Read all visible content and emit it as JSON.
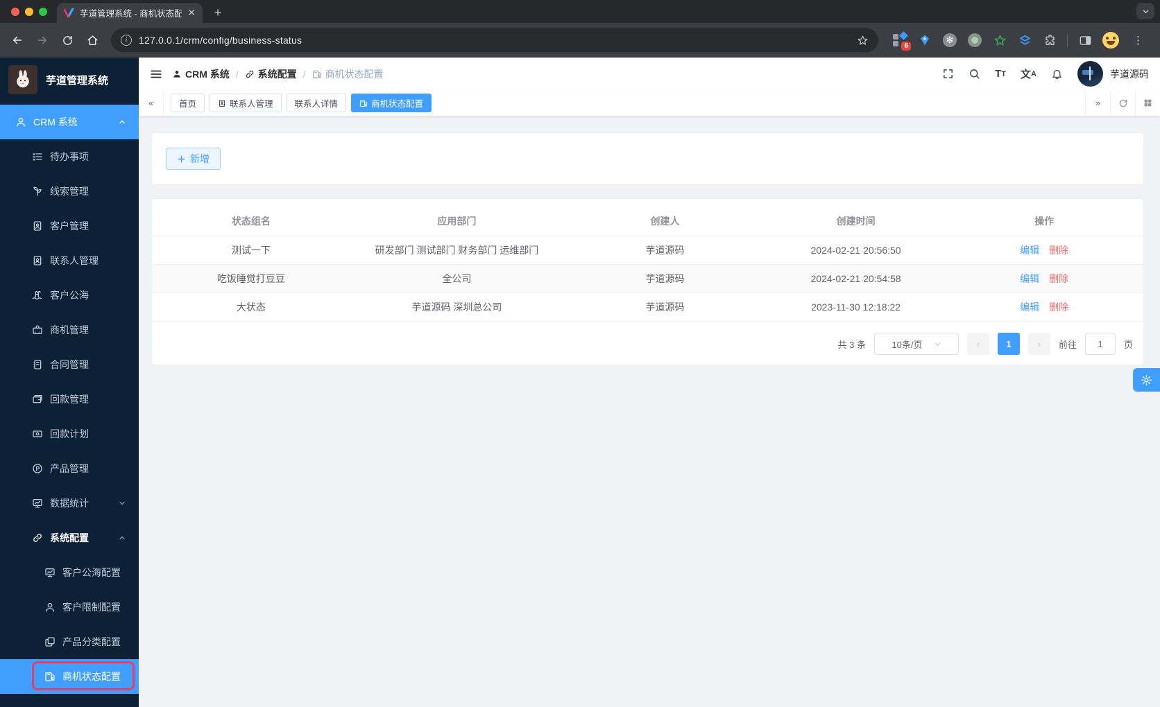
{
  "browser": {
    "tab_title": "芋道管理系统 - 商机状态配置",
    "url": "127.0.0.1/crm/config/business-status",
    "extension_badge": "6"
  },
  "sidebar": {
    "logo_title": "芋道管理系统",
    "menu": [
      {
        "label": "CRM 系统"
      },
      {
        "label": "待办事项"
      },
      {
        "label": "线索管理"
      },
      {
        "label": "客户管理"
      },
      {
        "label": "联系人管理"
      },
      {
        "label": "客户公海"
      },
      {
        "label": "商机管理"
      },
      {
        "label": "合同管理"
      },
      {
        "label": "回款管理"
      },
      {
        "label": "回款计划"
      },
      {
        "label": "产品管理"
      },
      {
        "label": "数据统计"
      },
      {
        "label": "系统配置"
      },
      {
        "label": "客户公海配置"
      },
      {
        "label": "客户限制配置"
      },
      {
        "label": "产品分类配置"
      },
      {
        "label": "商机状态配置"
      }
    ]
  },
  "header": {
    "breadcrumb": [
      {
        "label": "CRM 系统"
      },
      {
        "label": "系统配置"
      },
      {
        "label": "商机状态配置"
      }
    ],
    "separator": "/",
    "username": "芋道源码"
  },
  "tabsbar": {
    "tabs": [
      {
        "label": "首页"
      },
      {
        "label": "联系人管理"
      },
      {
        "label": "联系人详情"
      },
      {
        "label": "商机状态配置"
      }
    ]
  },
  "content": {
    "add_button": "新增",
    "table": {
      "columns": [
        "状态组名",
        "应用部门",
        "创建人",
        "创建时间",
        "操作"
      ],
      "rows": [
        {
          "group": "测试一下",
          "dept": "研发部门 测试部门 财务部门 运维部门",
          "creator": "芋道源码",
          "created": "2024-02-21 20:56:50",
          "edit": "编辑",
          "del": "删除"
        },
        {
          "group": "吃饭睡觉打豆豆",
          "dept": "全公司",
          "creator": "芋道源码",
          "created": "2024-02-21 20:54:58",
          "edit": "编辑",
          "del": "删除"
        },
        {
          "group": "大状态",
          "dept": "芋道源码 深圳总公司",
          "creator": "芋道源码",
          "created": "2023-11-30 12:18:22",
          "edit": "编辑",
          "del": "删除"
        }
      ]
    },
    "pagination": {
      "total": "共 3 条",
      "page_size": "10条/页",
      "page": "1",
      "goto": "前往",
      "goto_value": "1",
      "unit": "页"
    }
  },
  "colors": {
    "accent": "#409eff",
    "danger": "#f56c6c",
    "sidebar_bg": "#0c2135",
    "highlight_border": "#e83e63"
  }
}
